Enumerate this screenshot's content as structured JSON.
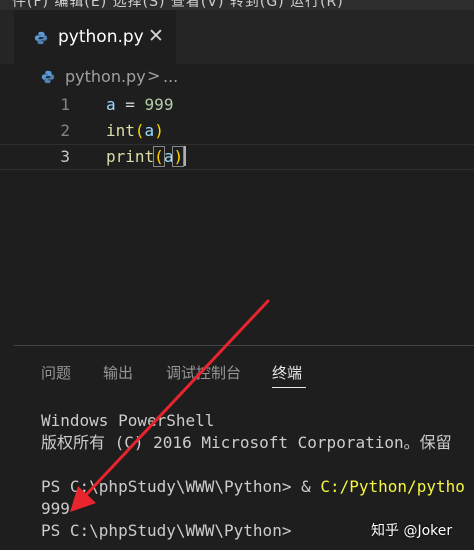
{
  "top_strip": {
    "text": "件(F) 编辑(E) 选择(S) 查看(V) 转到(G) 运行(R)"
  },
  "tab": {
    "label": "python.py",
    "close_glyph": "✕",
    "icon": "python-icon"
  },
  "breadcrumb": {
    "file": "python.py",
    "separator": ">",
    "more": "..."
  },
  "editor": {
    "lines": [
      {
        "number": "1",
        "tokens": [
          "a",
          " = ",
          "999"
        ]
      },
      {
        "number": "2",
        "tokens": [
          "int",
          "(",
          "a",
          ")"
        ]
      },
      {
        "number": "3",
        "tokens": [
          "print",
          "(",
          "a",
          ")"
        ]
      }
    ],
    "active_line": 3
  },
  "panel": {
    "tabs": [
      "问题",
      "输出",
      "调试控制台",
      "终端"
    ],
    "active_tab": "终端"
  },
  "terminal": {
    "lines": [
      "Windows PowerShell",
      "版权所有 (C) 2016 Microsoft Corporation。保留",
      "",
      "PS C:\\phpStudy\\WWW\\Python> & ",
      "999",
      "PS C:\\phpStudy\\WWW\\Python>"
    ],
    "run_path": "C:/Python/pytho"
  },
  "watermark": "知乎 @Joker",
  "colors": {
    "background": "#1e1e1e",
    "keyword_fn": "#dcdcaa",
    "variable": "#9cdcfe",
    "number": "#b5cea8",
    "bracket": "#ffd700",
    "terminal_path": "#f5f543",
    "arrow": "#e8242c"
  }
}
